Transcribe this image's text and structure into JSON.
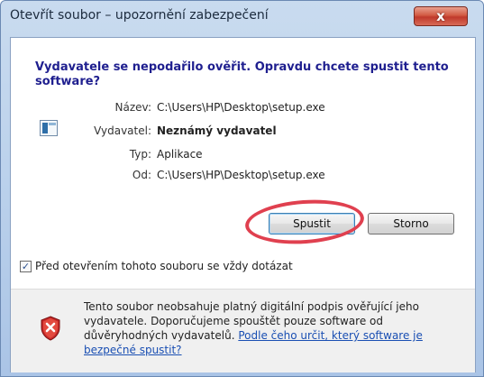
{
  "window": {
    "title": "Otevřít soubor – upozornění zabezpečení",
    "close_glyph": "x"
  },
  "dialog": {
    "heading": "Vydavatele se nepodařilo ověřit. Opravdu chcete spustit tento software?",
    "fields": [
      {
        "label": "Název:",
        "value": "C:\\Users\\HP\\Desktop\\setup.exe",
        "bold": false
      },
      {
        "label": "Vydavatel:",
        "value": "Neznámý vydavatel",
        "bold": true
      },
      {
        "label": "Typ:",
        "value": "Aplikace",
        "bold": false
      },
      {
        "label": "Od:",
        "value": "C:\\Users\\HP\\Desktop\\setup.exe",
        "bold": false
      }
    ],
    "buttons": {
      "run": "Spustit",
      "cancel": "Storno"
    },
    "checkbox": {
      "checked": true,
      "label": "Před otevřením tohoto souboru se vždy dotázat"
    },
    "warning": {
      "text": "Tento soubor neobsahuje platný digitální podpis ověřující jeho vydavatele. Doporučujeme spouštět pouze software od důvěryhodných vydavatelů.",
      "link": "Podle čeho určit, který software je bezpečné spustit?"
    }
  },
  "colors": {
    "heading": "#1f1f8f",
    "annotation_circle": "#e0404f",
    "link": "#1a4fb3"
  },
  "icons": {
    "app": "application-icon",
    "shield": "security-warning-shield-icon"
  }
}
